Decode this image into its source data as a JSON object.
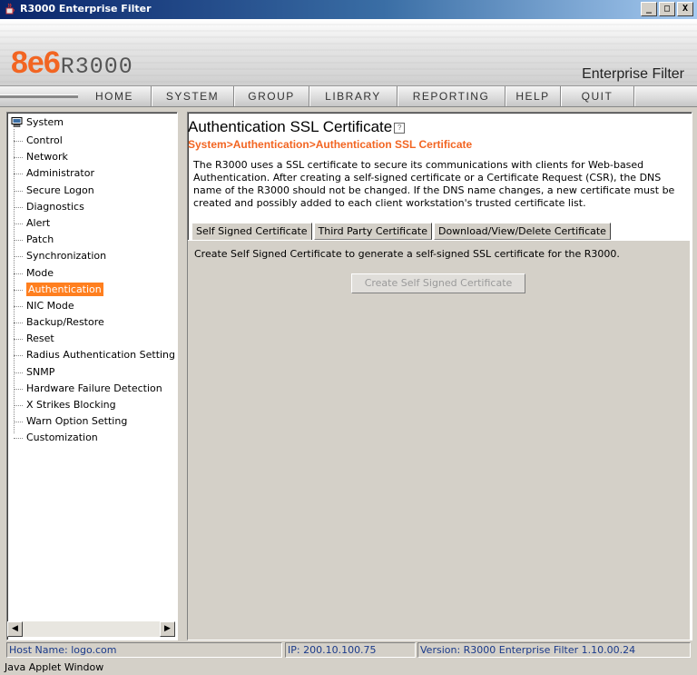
{
  "window": {
    "title": "R3000 Enterprise Filter",
    "controls": [
      "_",
      "□",
      "X"
    ]
  },
  "banner": {
    "logo_brand": "8e6",
    "logo_product": "R3000",
    "product_name": "Enterprise Filter"
  },
  "nav": {
    "items": [
      "HOME",
      "SYSTEM",
      "GROUP",
      "LIBRARY",
      "REPORTING",
      "HELP",
      "QUIT"
    ]
  },
  "tree": {
    "root": "System",
    "items": [
      "Control",
      "Network",
      "Administrator",
      "Secure Logon",
      "Diagnostics",
      "Alert",
      "Patch",
      "Synchronization",
      "Mode",
      "Authentication",
      "NIC Mode",
      "Backup/Restore",
      "Reset",
      "Radius Authentication Setting",
      "SNMP",
      "Hardware Failure Detection",
      "X Strikes Blocking",
      "Warn Option Setting",
      "Customization"
    ],
    "selected": "Authentication"
  },
  "page": {
    "title": "Authentication SSL Certificate",
    "breadcrumb": "System>Authentication>Authentication SSL Certificate",
    "description": "The R3000 uses a SSL certificate to secure its communications with clients for Web-based Authentication. After creating a self-signed certificate or a Certificate Request (CSR), the DNS name of the R3000 should not be changed. If the DNS name changes, a new certificate must be created and possibly added to each client workstation's trusted certificate list.",
    "tabs": [
      "Self Signed Certificate",
      "Third Party Certificate",
      "Download/View/Delete Certificate"
    ],
    "active_tab": "Self Signed Certificate",
    "panel_text": "Create Self Signed Certificate to generate a self-signed SSL certificate for the R3000.",
    "create_button": "Create Self Signed Certificate"
  },
  "status": {
    "host": "Host Name: logo.com",
    "ip": "IP: 200.10.100.75",
    "version": "Version: R3000 Enterprise Filter 1.10.00.24"
  },
  "applet_bar": "Java Applet Window",
  "colors": {
    "accent": "#f26522",
    "selected_bg": "#ff7f1f",
    "status_text": "#1a3a8a"
  }
}
